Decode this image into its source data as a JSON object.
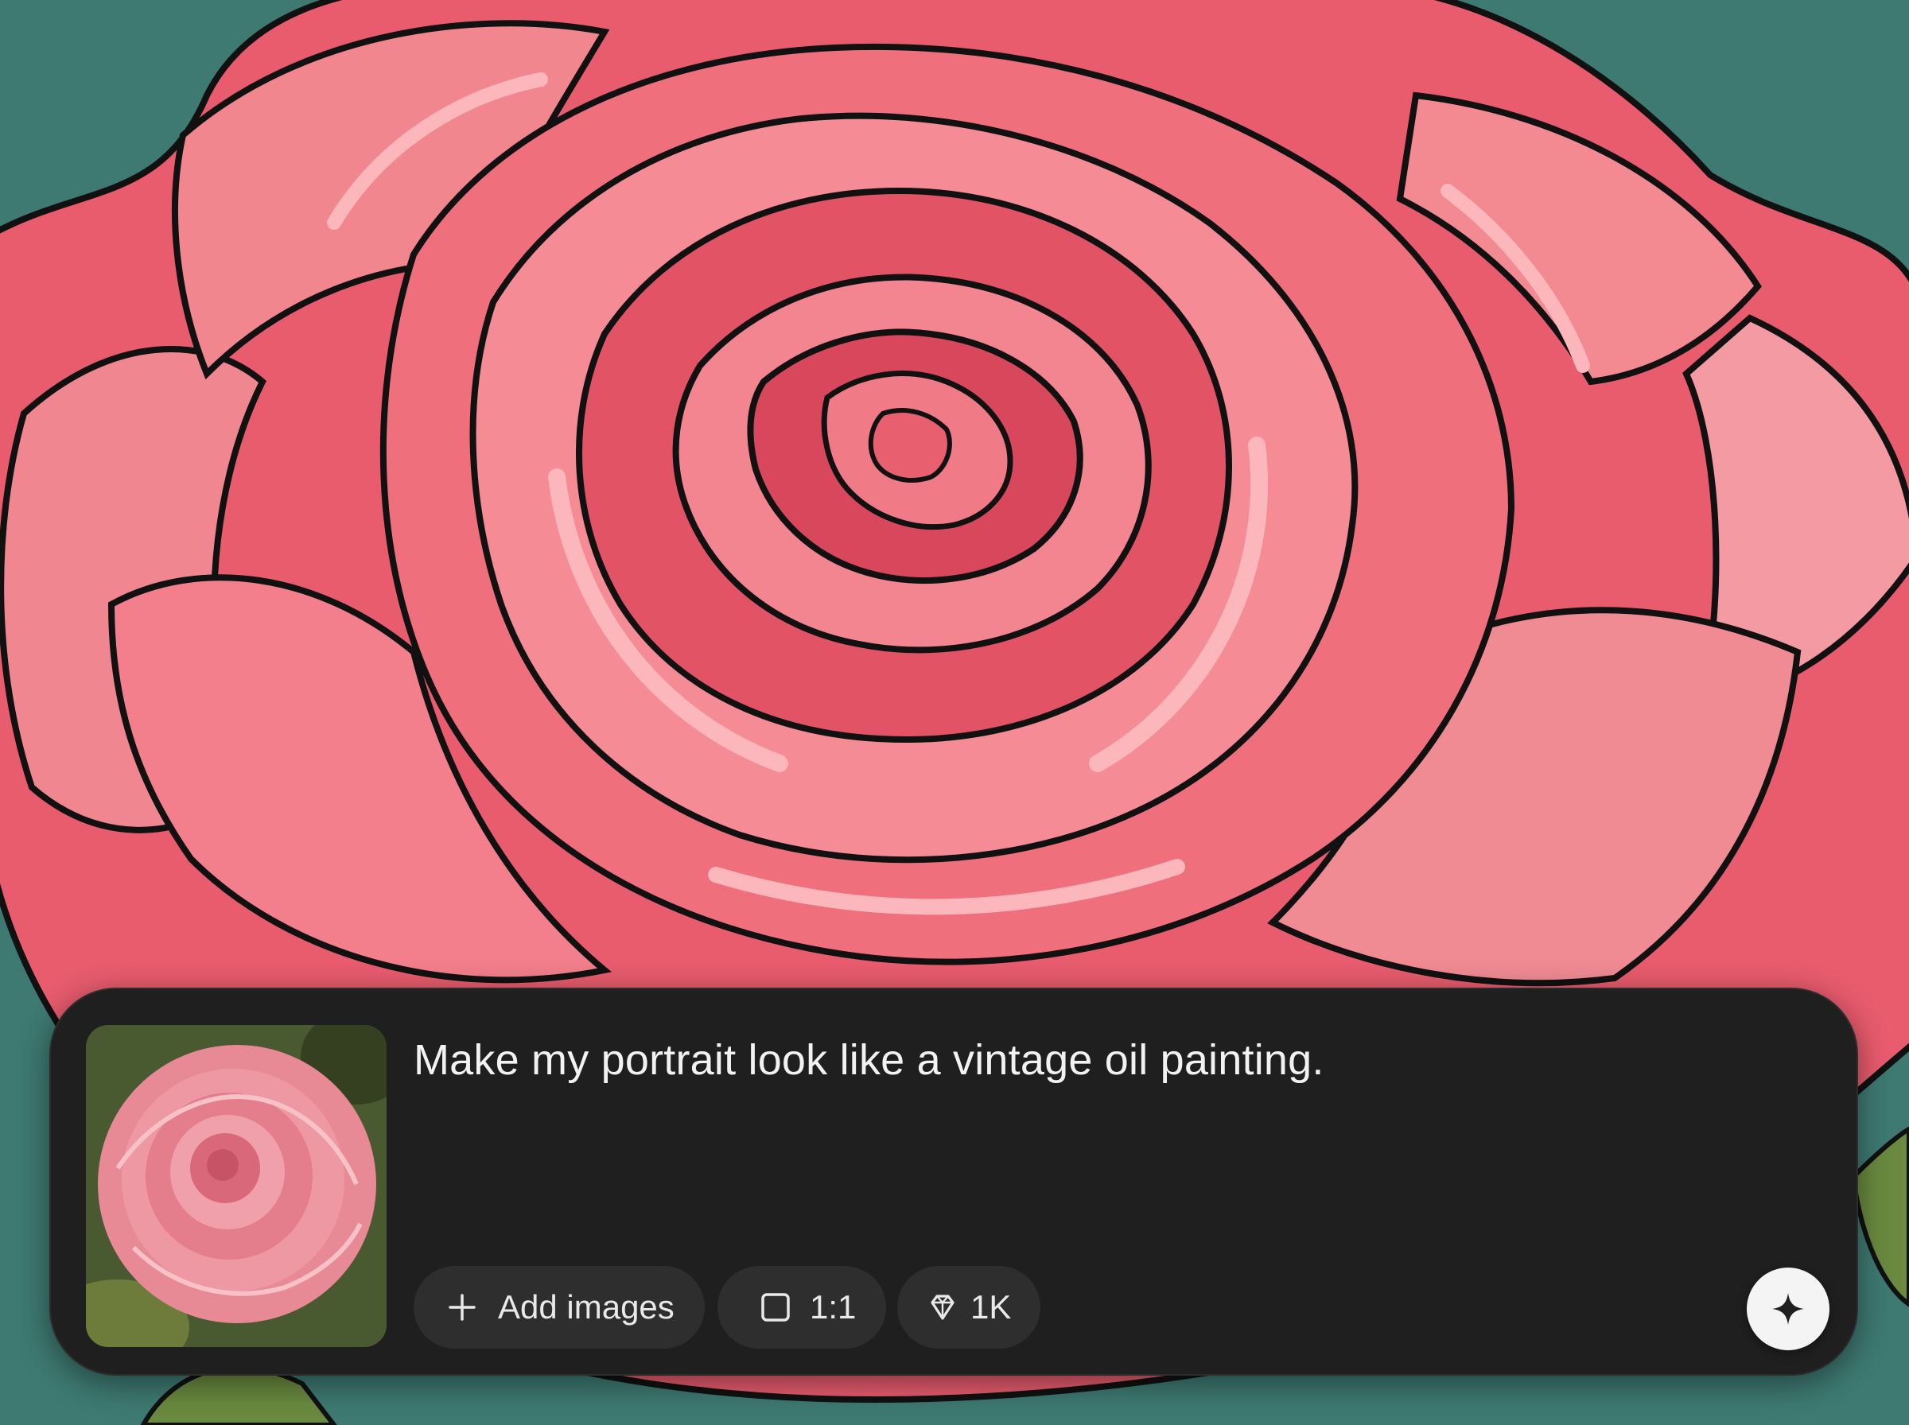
{
  "composer": {
    "prompt": "Make my portrait look like a vintage oil painting.",
    "attachment": {
      "subject": "pink rose photo",
      "icon": "image-thumbnail"
    },
    "options": {
      "add_images": {
        "label": "Add images",
        "icon": "plus-icon"
      },
      "aspect_ratio": {
        "label": "1:1",
        "icon": "square-icon"
      },
      "resolution": {
        "label": "1K",
        "icon": "diamond-icon"
      }
    },
    "submit": {
      "icon": "sparkle-icon"
    }
  },
  "colors": {
    "background_teal": "#3e7a72",
    "panel": "#1f1f1f",
    "chip": "#2e2e2e",
    "rose_pink": "#f07a83",
    "rose_deep": "#d94a5c"
  }
}
